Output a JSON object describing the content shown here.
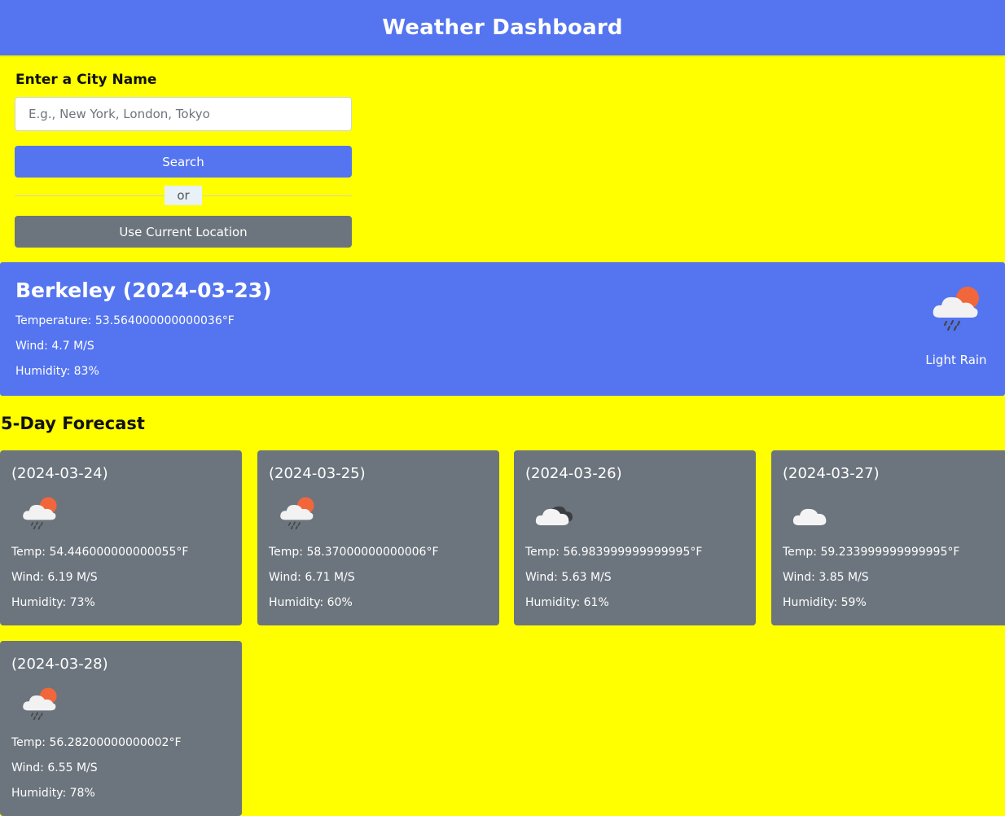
{
  "header": {
    "title": "Weather Dashboard"
  },
  "search": {
    "label": "Enter a City Name",
    "placeholder": "E.g., New York, London, Tokyo",
    "value": "",
    "search_button": "Search",
    "divider_text": "or",
    "location_button": "Use Current Location"
  },
  "current": {
    "title": "Berkeley (2024-03-23)",
    "temperature": "Temperature: 53.564000000000036°F",
    "wind": "Wind: 4.7 M/S",
    "humidity": "Humidity: 83%",
    "icon": "light-rain-icon",
    "description": "Light Rain"
  },
  "forecast": {
    "title": "5-Day Forecast",
    "days": [
      {
        "date": "(2024-03-24)",
        "icon": "light-rain-icon",
        "temp": "Temp: 54.446000000000055°F",
        "wind": "Wind: 6.19 M/S",
        "humidity": "Humidity: 73%"
      },
      {
        "date": "(2024-03-25)",
        "icon": "light-rain-icon",
        "temp": "Temp: 58.37000000000006°F",
        "wind": "Wind: 6.71 M/S",
        "humidity": "Humidity: 60%"
      },
      {
        "date": "(2024-03-26)",
        "icon": "broken-clouds-icon",
        "temp": "Temp: 56.983999999999995°F",
        "wind": "Wind: 5.63 M/S",
        "humidity": "Humidity: 61%"
      },
      {
        "date": "(2024-03-27)",
        "icon": "cloud-icon",
        "temp": "Temp: 59.233999999999995°F",
        "wind": "Wind: 3.85 M/S",
        "humidity": "Humidity: 59%"
      },
      {
        "date": "(2024-03-28)",
        "icon": "light-rain-icon",
        "temp": "Temp: 56.28200000000002°F",
        "wind": "Wind: 6.55 M/S",
        "humidity": "Humidity: 78%"
      }
    ]
  },
  "colors": {
    "page_background": "#ffff00",
    "primary": "#5475ef",
    "secondary": "#6c757d",
    "sun": "#f2663c"
  }
}
